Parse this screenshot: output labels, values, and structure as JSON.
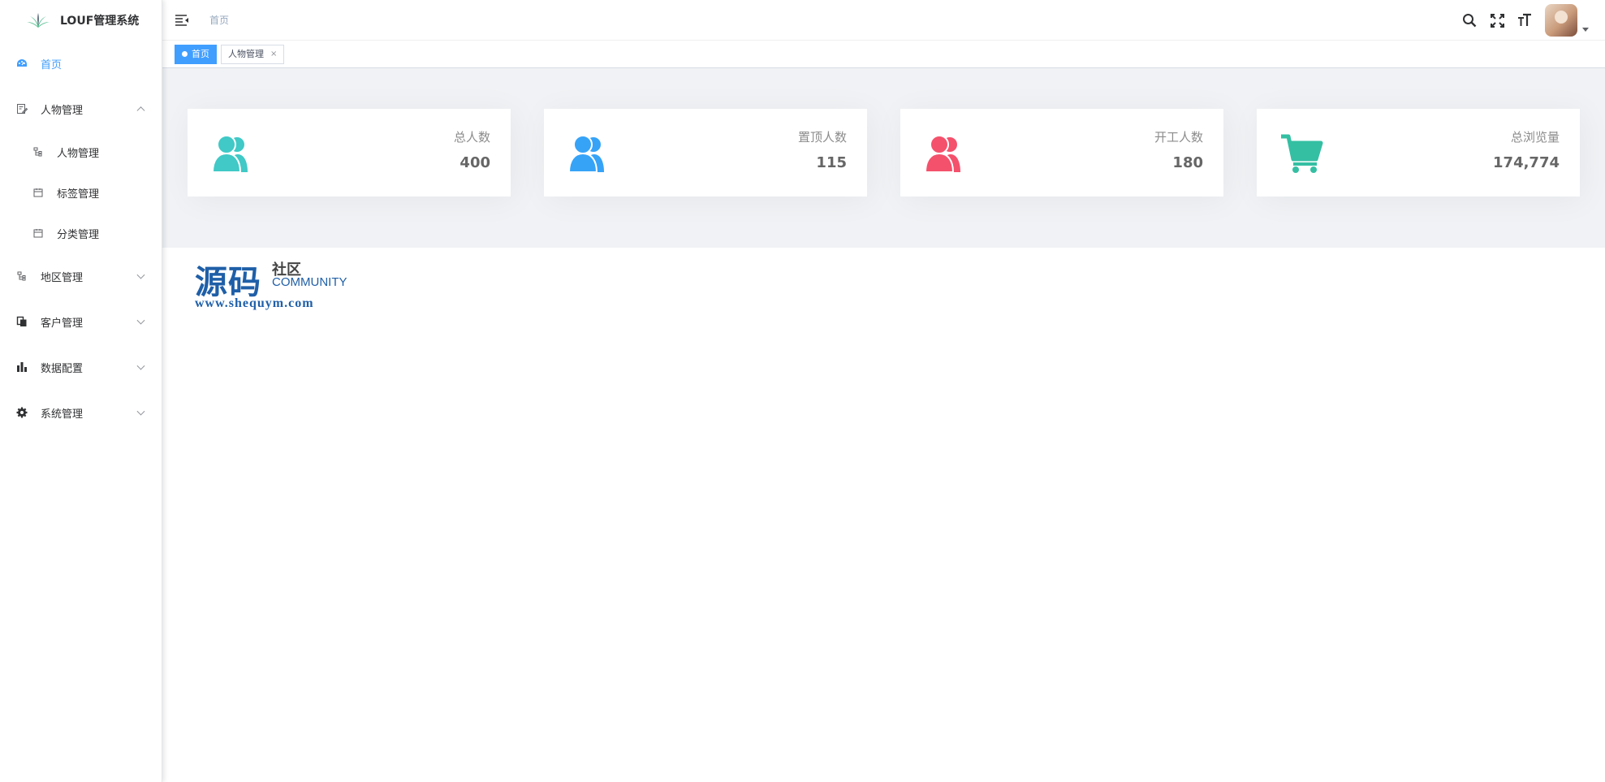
{
  "app": {
    "title": "LOUF管理系统"
  },
  "sidebar": {
    "items": [
      {
        "label": "首页",
        "icon": "dashboard-icon",
        "active": true
      },
      {
        "label": "人物管理",
        "icon": "edit-doc-icon",
        "expanded": true,
        "children": [
          {
            "label": "人物管理",
            "icon": "tree-icon"
          },
          {
            "label": "标签管理",
            "icon": "calendar-icon"
          },
          {
            "label": "分类管理",
            "icon": "calendar-icon"
          }
        ]
      },
      {
        "label": "地区管理",
        "icon": "tree-icon",
        "expanded": false
      },
      {
        "label": "客户管理",
        "icon": "clipboard-icon",
        "expanded": false
      },
      {
        "label": "数据配置",
        "icon": "bar-chart-icon",
        "expanded": false
      },
      {
        "label": "系统管理",
        "icon": "gear-icon",
        "expanded": false
      }
    ]
  },
  "header": {
    "breadcrumb": "首页"
  },
  "tags": [
    {
      "label": "首页",
      "active": true
    },
    {
      "label": "人物管理",
      "active": false,
      "close": "×"
    }
  ],
  "cards": [
    {
      "label": "总人数",
      "value": "400",
      "icon": "people-icon",
      "color": "#40c9c6"
    },
    {
      "label": "置顶人数",
      "value": "115",
      "icon": "people-icon",
      "color": "#36a3f7"
    },
    {
      "label": "开工人数",
      "value": "180",
      "icon": "people-icon",
      "color": "#f4516c"
    },
    {
      "label": "总浏览量",
      "value": "174,774",
      "icon": "shopping-cart-icon",
      "color": "#34bfa3"
    }
  ],
  "watermark": {
    "main": "源码",
    "sub": "社区",
    "eng": "COMMUNITY",
    "url": "www.shequym.com"
  },
  "colors": {
    "accent": "#409eff",
    "background": "#f0f2f5"
  }
}
